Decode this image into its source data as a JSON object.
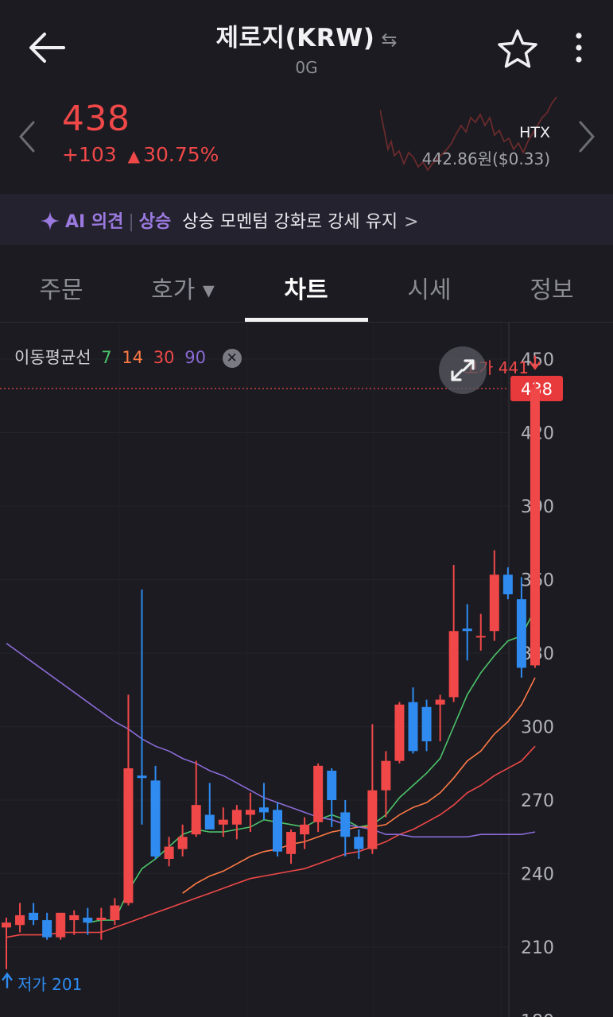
{
  "header": {
    "title": "제로지(KRW)",
    "swap_icon": "swap-icon",
    "subtitle": "0G",
    "back_icon": "arrow-left-icon",
    "favorite_icon": "star-icon",
    "more_icon": "more-vertical-icon"
  },
  "price_section": {
    "price": "438",
    "change_abs": "+103",
    "change_pct": "30.75%",
    "direction": "up",
    "exchange": "HTX",
    "exchange_price": "442.86원($0.33)",
    "up_color": "#f04848"
  },
  "ai_banner": {
    "label": "AI 의견",
    "separator": "|",
    "trend": "상승",
    "text": "상승 모멘텀 강화로 강세 유지",
    "accent_color": "#9b7ae0"
  },
  "tabs": [
    {
      "label": "주문"
    },
    {
      "label": "호가 ▾"
    },
    {
      "label": "차트",
      "active": true
    },
    {
      "label": "시세"
    },
    {
      "label": "정보"
    }
  ],
  "ma_legend": {
    "label": "이동평균선",
    "periods": [
      {
        "value": "7",
        "color": "#4cc46a"
      },
      {
        "value": "14",
        "color": "#ff7a45"
      },
      {
        "value": "30",
        "color": "#f04848"
      },
      {
        "value": "90",
        "color": "#8b6bd6"
      }
    ]
  },
  "chart_data": {
    "type": "candlestick",
    "y_ticks": [
      "450",
      "420",
      "390",
      "360",
      "330",
      "300",
      "270",
      "240",
      "210",
      "180"
    ],
    "ylim": [
      180,
      450
    ],
    "current_price_label": "438",
    "current_price": 438,
    "high_label": "고가 441",
    "high_value": 441,
    "low_label": "저가 201",
    "low_value": 201,
    "up_color": "#f04848",
    "down_color": "#2f8bf0",
    "candles": [
      {
        "o": 218,
        "h": 222,
        "l": 201,
        "c": 220
      },
      {
        "o": 219,
        "h": 228,
        "l": 216,
        "c": 223
      },
      {
        "o": 224,
        "h": 228,
        "l": 219,
        "c": 221
      },
      {
        "o": 221,
        "h": 224,
        "l": 213,
        "c": 214
      },
      {
        "o": 214,
        "h": 224,
        "l": 213,
        "c": 224
      },
      {
        "o": 221,
        "h": 225,
        "l": 215,
        "c": 223
      },
      {
        "o": 222,
        "h": 226,
        "l": 215,
        "c": 220
      },
      {
        "o": 221,
        "h": 226,
        "l": 213,
        "c": 222
      },
      {
        "o": 221,
        "h": 230,
        "l": 219,
        "c": 227
      },
      {
        "o": 228,
        "h": 313,
        "l": 227,
        "c": 283
      },
      {
        "o": 280,
        "h": 356,
        "l": 260,
        "c": 279
      },
      {
        "o": 278,
        "h": 284,
        "l": 246,
        "c": 247
      },
      {
        "o": 246,
        "h": 255,
        "l": 243,
        "c": 251
      },
      {
        "o": 250,
        "h": 260,
        "l": 247,
        "c": 255
      },
      {
        "o": 256,
        "h": 286,
        "l": 255,
        "c": 268
      },
      {
        "o": 264,
        "h": 277,
        "l": 259,
        "c": 258
      },
      {
        "o": 260,
        "h": 267,
        "l": 255,
        "c": 262
      },
      {
        "o": 260,
        "h": 268,
        "l": 254,
        "c": 266
      },
      {
        "o": 264,
        "h": 273,
        "l": 257,
        "c": 266
      },
      {
        "o": 267,
        "h": 277,
        "l": 262,
        "c": 265
      },
      {
        "o": 266,
        "h": 269,
        "l": 247,
        "c": 249
      },
      {
        "o": 248,
        "h": 258,
        "l": 244,
        "c": 257
      },
      {
        "o": 256,
        "h": 263,
        "l": 250,
        "c": 260
      },
      {
        "o": 261,
        "h": 285,
        "l": 257,
        "c": 284
      },
      {
        "o": 282,
        "h": 283,
        "l": 259,
        "c": 270
      },
      {
        "o": 265,
        "h": 270,
        "l": 247,
        "c": 255
      },
      {
        "o": 255,
        "h": 258,
        "l": 246,
        "c": 250
      },
      {
        "o": 250,
        "h": 301,
        "l": 248,
        "c": 274
      },
      {
        "o": 274,
        "h": 290,
        "l": 263,
        "c": 286
      },
      {
        "o": 286,
        "h": 310,
        "l": 285,
        "c": 309
      },
      {
        "o": 310,
        "h": 316,
        "l": 289,
        "c": 290
      },
      {
        "o": 308,
        "h": 311,
        "l": 290,
        "c": 294
      },
      {
        "o": 309,
        "h": 313,
        "l": 294,
        "c": 311
      },
      {
        "o": 312,
        "h": 366,
        "l": 310,
        "c": 339
      },
      {
        "o": 340,
        "h": 350,
        "l": 327,
        "c": 339
      },
      {
        "o": 337,
        "h": 346,
        "l": 331,
        "c": 337
      },
      {
        "o": 339,
        "h": 372,
        "l": 335,
        "c": 362
      },
      {
        "o": 362,
        "h": 365,
        "l": 352,
        "c": 354
      },
      {
        "o": 352,
        "h": 361,
        "l": 320,
        "c": 324
      },
      {
        "o": 325,
        "h": 441,
        "l": 324,
        "c": 438
      }
    ],
    "ma": [
      {
        "period": 7,
        "color": "#4cc46a",
        "values": [
          null,
          null,
          null,
          null,
          null,
          null,
          220,
          221,
          221,
          233,
          242,
          246,
          251,
          256,
          258,
          257,
          257,
          258,
          259,
          262,
          261,
          260,
          259,
          262,
          264,
          262,
          259,
          260,
          264,
          271,
          276,
          281,
          287,
          300,
          313,
          322,
          329,
          335,
          337,
          348
        ]
      },
      {
        "period": 14,
        "color": "#ff7a45",
        "values": [
          null,
          null,
          null,
          null,
          null,
          null,
          null,
          null,
          null,
          null,
          null,
          null,
          null,
          232,
          236,
          239,
          241,
          244,
          247,
          249,
          250,
          252,
          253,
          255,
          257,
          258,
          259,
          259,
          260,
          264,
          267,
          269,
          273,
          279,
          286,
          290,
          297,
          302,
          309,
          320
        ]
      },
      {
        "period": 30,
        "color": "#f04848",
        "values": [
          214,
          215,
          215,
          215,
          216,
          216,
          216,
          216,
          218,
          220,
          222,
          224,
          226,
          228,
          230,
          232,
          234,
          236,
          238,
          239,
          240,
          241,
          242,
          244,
          246,
          248,
          249,
          251,
          253,
          256,
          258,
          261,
          264,
          268,
          273,
          276,
          280,
          283,
          286,
          292
        ]
      },
      {
        "period": 90,
        "color": "#8b6bd6",
        "values": [
          334,
          330,
          326,
          322,
          318,
          314,
          310,
          306,
          302,
          299,
          295,
          292,
          290,
          287,
          285,
          282,
          280,
          277,
          274,
          271,
          269,
          267,
          265,
          263,
          262,
          260,
          259,
          258,
          256,
          256,
          255,
          255,
          255,
          255,
          255,
          256,
          256,
          256,
          256,
          257
        ]
      }
    ]
  }
}
